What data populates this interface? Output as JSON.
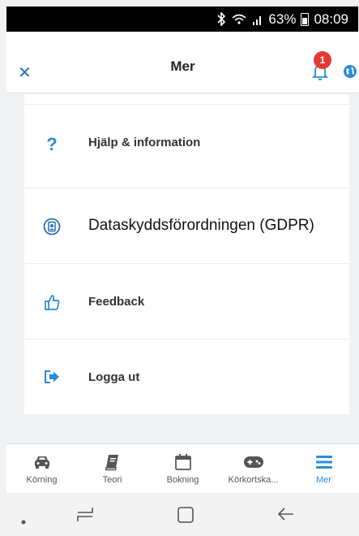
{
  "status_bar": {
    "battery": "63%",
    "time": "08:09"
  },
  "header": {
    "title": "Mer",
    "notification_count": "1"
  },
  "menu_items": [
    {
      "label": "Hjälp & information",
      "icon": "question-icon"
    },
    {
      "label": "Dataskyddsförordningen (GDPR)",
      "icon": "gdpr-icon"
    },
    {
      "label": "Feedback",
      "icon": "thumbs-up-icon"
    },
    {
      "label": "Logga ut",
      "icon": "logout-icon"
    }
  ],
  "tabs": [
    {
      "label": "Körning",
      "icon": "car-icon"
    },
    {
      "label": "Teori",
      "icon": "book-icon"
    },
    {
      "label": "Bokning",
      "icon": "calendar-icon"
    },
    {
      "label": "Körkortska...",
      "icon": "gamepad-icon"
    },
    {
      "label": "Mer",
      "icon": "menu-icon"
    }
  ],
  "colors": {
    "accent": "#2a8bd6",
    "badge": "#e53935",
    "icon_blue": "#2a6fb0"
  }
}
